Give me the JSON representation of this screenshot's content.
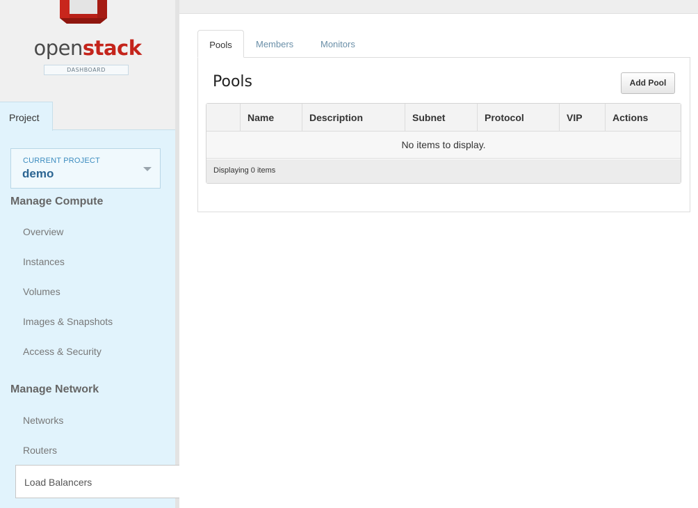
{
  "brand": {
    "open": "open",
    "stack": "stack",
    "subtitle": "DASHBOARD"
  },
  "sidebar": {
    "tab": "Project",
    "current_project": {
      "label": "CURRENT PROJECT",
      "value": "demo"
    },
    "sections": [
      {
        "heading": "Manage Compute",
        "items": [
          "Overview",
          "Instances",
          "Volumes",
          "Images & Snapshots",
          "Access & Security"
        ]
      },
      {
        "heading": "Manage Network",
        "items": [
          "Networks",
          "Routers",
          "Load Balancers"
        ]
      }
    ],
    "active_item": "Load Balancers"
  },
  "main": {
    "tabs": [
      {
        "label": "Pools",
        "active": true
      },
      {
        "label": "Members",
        "active": false
      },
      {
        "label": "Monitors",
        "active": false
      }
    ],
    "title": "Pools",
    "add_button": "Add Pool",
    "table": {
      "columns": [
        "",
        "Name",
        "Description",
        "Subnet",
        "Protocol",
        "VIP",
        "Actions"
      ],
      "rows": [],
      "empty_message": "No items to display.",
      "footer": "Displaying 0 items"
    }
  },
  "colors": {
    "brand_red": "#c4241b",
    "sidebar_panel": "#e1f3fc",
    "project_value": "#2b6592",
    "tab_link": "#6a8fa8"
  },
  "icons": {
    "logo": "openstack-cube-logo",
    "dropdown": "caret-down-icon"
  }
}
